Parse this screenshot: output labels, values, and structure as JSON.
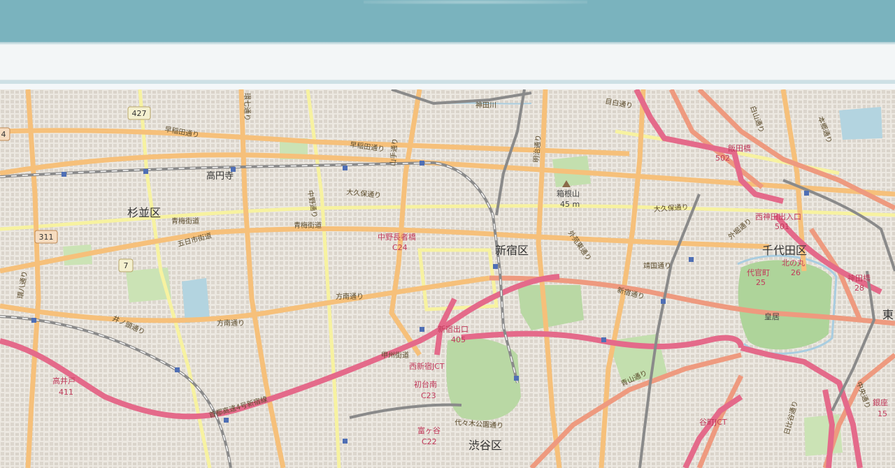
{
  "header": {
    "title": ""
  },
  "map": {
    "districts": [
      {
        "name": "杉並区"
      },
      {
        "name": "新宿区"
      },
      {
        "name": "千代田区"
      },
      {
        "name": "渋谷区"
      },
      {
        "name": "東"
      }
    ],
    "stations": [
      {
        "name": "高円寺"
      }
    ],
    "pois": [
      {
        "name": "箱根山",
        "sub": "45 m"
      },
      {
        "name": "皇居"
      }
    ],
    "interchanges": [
      {
        "name": "飯田橋",
        "code": "502"
      },
      {
        "name": "西神田出入口",
        "code": "501"
      },
      {
        "name": "中野長者橋",
        "code": "C24"
      },
      {
        "name": "代官町",
        "code": "25"
      },
      {
        "name": "北の丸",
        "code": "26"
      },
      {
        "name": "神田橋",
        "code": "28"
      },
      {
        "name": "新宿出口",
        "code": "405"
      },
      {
        "name": "西新宿JCT",
        "code": ""
      },
      {
        "name": "初台南",
        "code": "C23"
      },
      {
        "name": "富ヶ谷",
        "code": "C22"
      },
      {
        "name": "高井戸",
        "code": "411"
      },
      {
        "name": "谷町JCT",
        "code": ""
      },
      {
        "name": "銀座",
        "code": "15"
      }
    ],
    "route_shields": [
      "427",
      "311",
      "7",
      "4"
    ],
    "roads": [
      "早稲田通り",
      "早稲田通り",
      "大久保通り",
      "大久保通り",
      "青梅街道",
      "青梅街道",
      "五日市街道",
      "方南通り",
      "方南通り",
      "井ノ頭通り",
      "甲州街道",
      "首都高速4号新宿線",
      "環七通り",
      "環八通り",
      "中野通り",
      "山手通り",
      "明治通り",
      "靖国通り",
      "新宿通り",
      "外苑東通り",
      "目白通り",
      "代々木公園通り",
      "青山通り",
      "外堀通り",
      "日比谷通り",
      "本郷通り",
      "白山通り",
      "中央通り",
      "神田川"
    ]
  }
}
